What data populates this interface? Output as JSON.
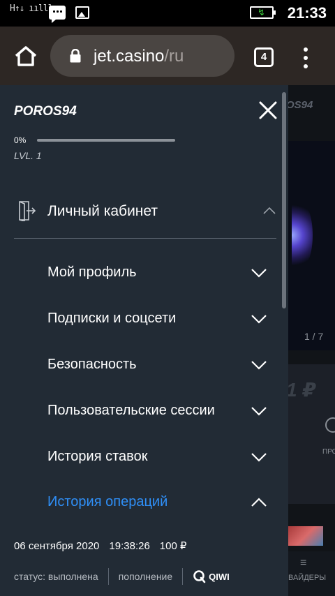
{
  "statusbar": {
    "signal": "H↑↓ ıılll,",
    "time": "21:33"
  },
  "browser": {
    "domain": "jet.casino",
    "path": "/ru",
    "tab_count": "4"
  },
  "background": {
    "user": "OS94",
    "slide": "1 / 7",
    "amount": "1 ₽",
    "promo": "ПРО",
    "nav_label": "ВАЙДЕРЫ"
  },
  "drawer": {
    "username": "POROS94",
    "progress": {
      "percent_label": "0%",
      "value": 0
    },
    "level": "LVL. 1",
    "cabinet_label": "Личный кабинет",
    "items": [
      {
        "label": "Мой профиль",
        "expanded": false
      },
      {
        "label": "Подписки и соцсети",
        "expanded": false
      },
      {
        "label": "Безопасность",
        "expanded": false
      },
      {
        "label": "Пользовательские сессии",
        "expanded": false
      },
      {
        "label": "История ставок",
        "expanded": false
      },
      {
        "label": "История операций",
        "expanded": true
      }
    ],
    "operation": {
      "date": "06 сентября 2020",
      "time": "19:38:26",
      "amount": "100 ₽",
      "status": "статус: выполнена",
      "type": "пополнение",
      "method": "QIWI"
    }
  },
  "colors": {
    "drawer_bg": "#222b35",
    "accent": "#2f8ff7",
    "browser_bg": "#2d2724"
  }
}
